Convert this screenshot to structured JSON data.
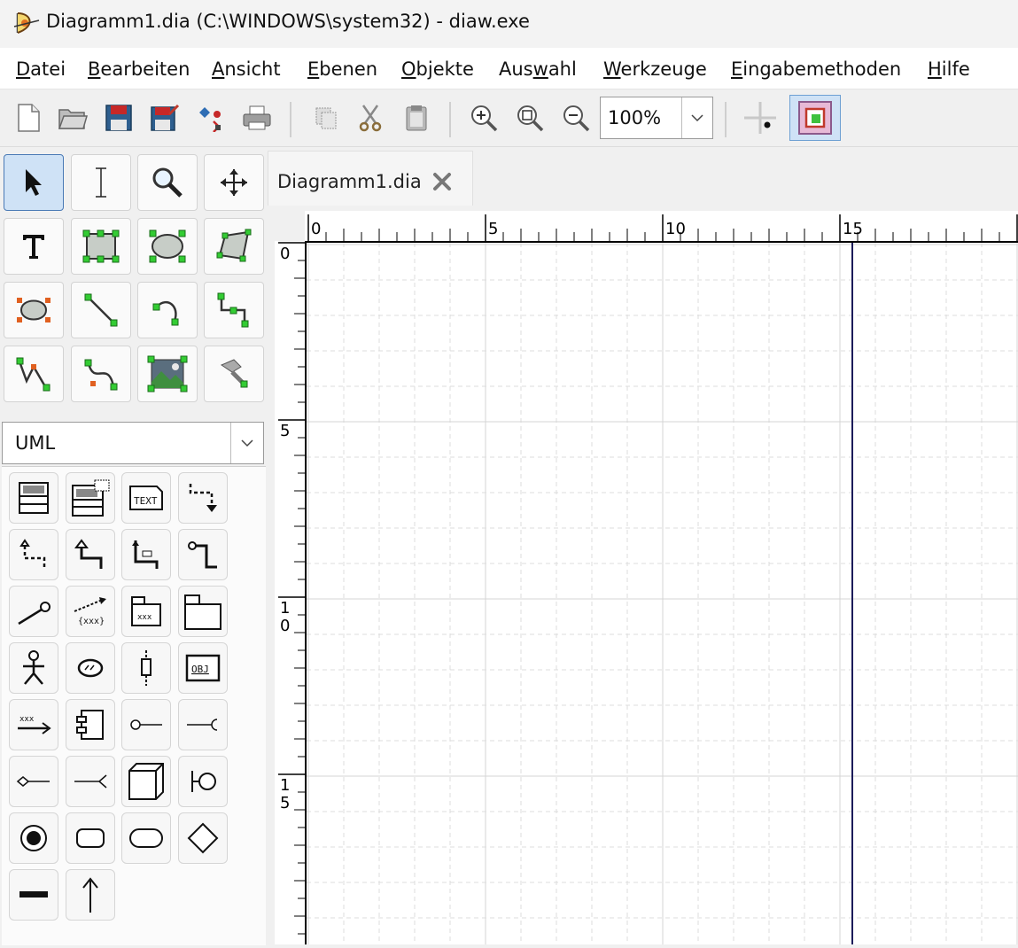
{
  "window": {
    "title": "Diagramm1.dia (C:\\WINDOWS\\system32) - diaw.exe",
    "app_icon": "dia-app-icon"
  },
  "menubar": {
    "items": [
      {
        "label": "Datei",
        "accel": "D"
      },
      {
        "label": "Bearbeiten",
        "accel": "B"
      },
      {
        "label": "Ansicht",
        "accel": "A"
      },
      {
        "label": "Ebenen",
        "accel": "E"
      },
      {
        "label": "Objekte",
        "accel": "O"
      },
      {
        "label": "Auswahl",
        "accel": "w"
      },
      {
        "label": "Werkzeuge",
        "accel": "W"
      },
      {
        "label": "Eingabemethoden",
        "accel": "E"
      },
      {
        "label": "Hilfe",
        "accel": "H"
      }
    ]
  },
  "toolbar": {
    "icons": [
      "new-icon",
      "open-icon",
      "save-icon",
      "save-as-icon",
      "export-icon",
      "print-icon",
      "copy-icon",
      "cut-icon",
      "paste-icon",
      "zoom-in-icon",
      "zoom-fit-icon",
      "zoom-out-icon",
      "snap-to-grid-icon",
      "snap-to-objects-icon"
    ],
    "zoom_value": "100%"
  },
  "toolbox": {
    "tools": [
      "modify-tool",
      "text-edit-tool",
      "magnify-tool",
      "scroll-tool",
      "text-tool",
      "box-tool",
      "ellipse-tool",
      "polygon-tool",
      "beziergon-tool",
      "line-tool",
      "arc-tool",
      "zigzagline-tool",
      "polyline-tool",
      "bezierline-tool",
      "image-tool",
      "outline-tool"
    ]
  },
  "sheet": {
    "selected": "UML"
  },
  "shapes": {
    "items": [
      "uml-class",
      "uml-template-class",
      "uml-note",
      "uml-dependency",
      "uml-realizes",
      "uml-generalization",
      "uml-association",
      "uml-implements",
      "uml-constraint",
      "uml-small-package",
      "uml-large-package",
      "uml-actor",
      "uml-usecase",
      "uml-lifeline",
      "uml-object",
      "uml-message",
      "uml-component",
      "uml-lollipop-provided",
      "uml-lollipop-required",
      "uml-lollipop-left",
      "uml-lollipop-right",
      "uml-node",
      "uml-classicon",
      "uml-state-term",
      "uml-state",
      "uml-activity",
      "uml-branch",
      "uml-fork",
      "uml-transition"
    ]
  },
  "tab": {
    "label": "Diagramm1.dia"
  },
  "rulers": {
    "horizontal_labels": [
      "0",
      "5",
      "10",
      "15"
    ],
    "vertical_labels": [
      "0",
      "5",
      "10",
      "15"
    ]
  },
  "colors": {
    "grid_major": "#d4d4d4",
    "grid_minor": "#dcdcdc",
    "page_break": "#1c1c5a",
    "active_blue": "#cfe2f6"
  }
}
